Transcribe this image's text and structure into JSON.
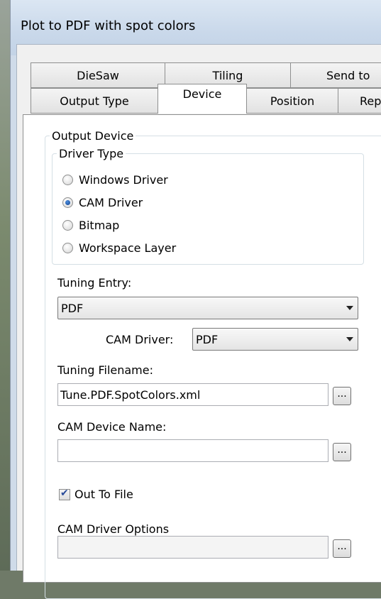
{
  "window": {
    "title": "Plot to PDF with spot colors"
  },
  "tabs_row1": [
    "DieSaw",
    "Tiling",
    "Send to"
  ],
  "tabs_row2": [
    "Output Type",
    "Device",
    "Position",
    "Rep"
  ],
  "active_tab": "Device",
  "output_device": {
    "legend": "Output Device",
    "driver_type": {
      "legend": "Driver Type",
      "options": [
        "Windows Driver",
        "CAM Driver",
        "Bitmap",
        "Workspace Layer"
      ],
      "selected": "CAM Driver"
    },
    "tuning_entry": {
      "label": "Tuning Entry:",
      "value": "PDF"
    },
    "cam_driver": {
      "label": "CAM Driver:",
      "value": "PDF"
    },
    "tuning_filename": {
      "label": "Tuning Filename:",
      "value": "Tune.PDF.SpotColors.xml",
      "browse": "..."
    },
    "cam_device_name": {
      "label": "CAM Device Name:",
      "value": "",
      "browse": "..."
    },
    "out_to_file": {
      "label": "Out To File",
      "checked": true
    },
    "cam_driver_options": {
      "label": "CAM Driver Options",
      "value": "",
      "browse": "..."
    }
  }
}
